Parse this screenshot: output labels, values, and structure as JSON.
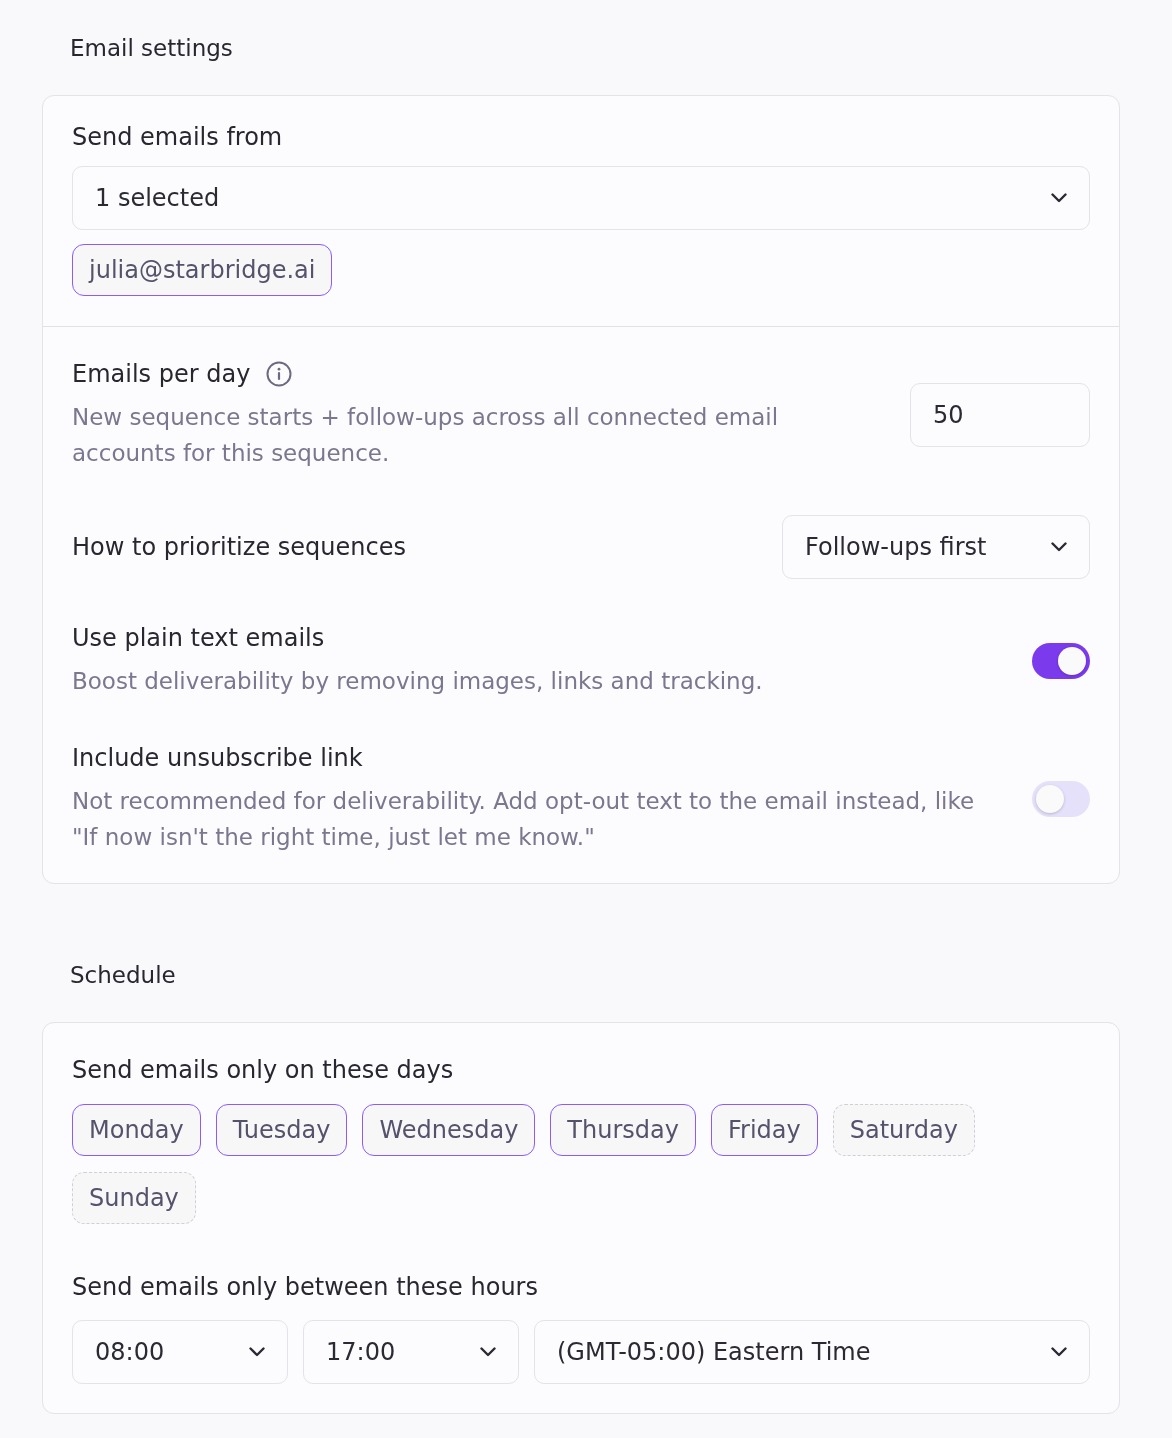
{
  "email_settings": {
    "title": "Email settings",
    "send_from": {
      "label": "Send emails from",
      "select": {
        "value": "1 selected"
      },
      "chips": [
        {
          "label": "julia@starbridge.ai",
          "selected": true
        }
      ]
    },
    "settings": [
      {
        "kind": "number",
        "label": "Emails per day",
        "info": true,
        "description": "New sequence starts + follow-ups across all connected email accounts for this sequence.",
        "value": "50"
      },
      {
        "kind": "select",
        "label": "How to prioritize sequences",
        "value": "Follow-ups first"
      },
      {
        "kind": "toggle",
        "label": "Use plain text emails",
        "description": "Boost deliverability by removing images, links and tracking.",
        "on": true
      },
      {
        "kind": "toggle",
        "label": "Include unsubscribe link",
        "description": "Not recommended for deliverability. Add opt-out text to the email instead, like \"If now isn't the right time, just let me know.\"",
        "on": false
      }
    ]
  },
  "schedule": {
    "title": "Schedule",
    "days_label": "Send emails only on these days",
    "days": [
      {
        "label": "Monday",
        "selected": true
      },
      {
        "label": "Tuesday",
        "selected": true
      },
      {
        "label": "Wednesday",
        "selected": true
      },
      {
        "label": "Thursday",
        "selected": true
      },
      {
        "label": "Friday",
        "selected": true
      },
      {
        "label": "Saturday",
        "selected": false
      },
      {
        "label": "Sunday",
        "selected": false
      }
    ],
    "hours_label": "Send emails only between these hours",
    "start": {
      "value": "08:00"
    },
    "end": {
      "value": "17:00"
    },
    "timezone": {
      "value": "(GMT-05:00) Eastern Time"
    }
  }
}
